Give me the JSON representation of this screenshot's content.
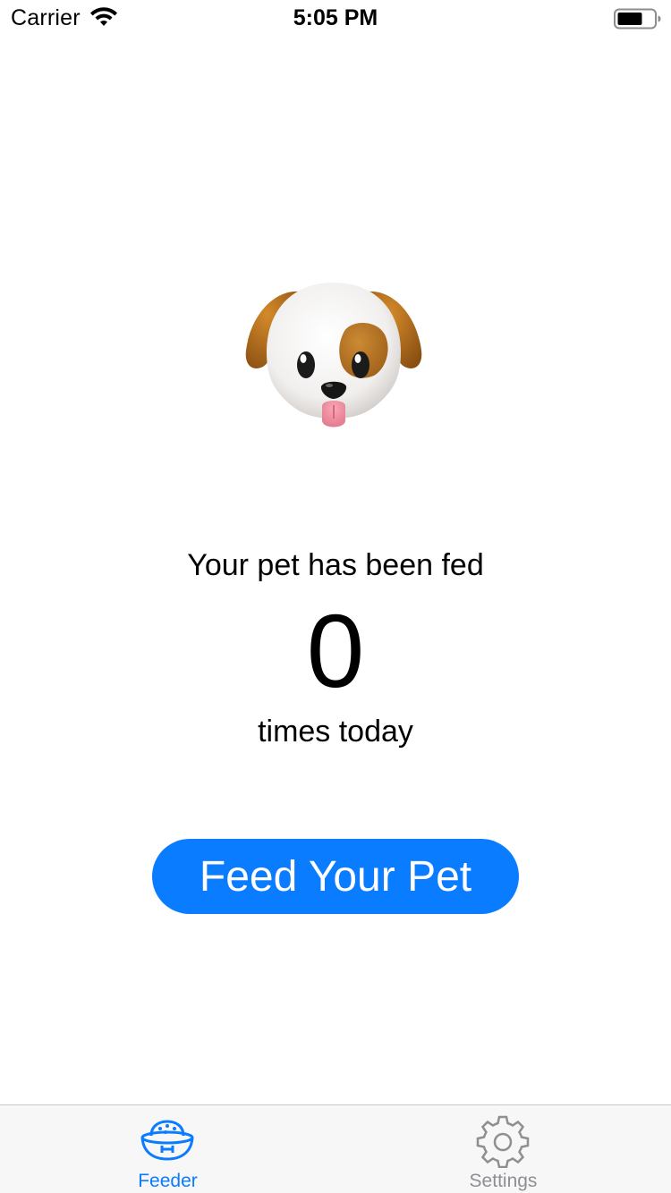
{
  "status_bar": {
    "carrier": "Carrier",
    "time": "5:05 PM",
    "wifi_icon": "wifi-icon",
    "battery_icon": "battery-icon"
  },
  "main": {
    "pet_icon": "dog-face-emoji",
    "fed_label": "Your pet has been fed",
    "feed_count": "0",
    "times_label": "times today",
    "feed_button_label": "Feed Your Pet"
  },
  "tab_bar": {
    "tabs": [
      {
        "label": "Feeder",
        "icon": "pet-bowl-icon",
        "selected": true
      },
      {
        "label": "Settings",
        "icon": "gear-icon",
        "selected": false
      }
    ]
  },
  "colors": {
    "accent": "#0a7cff",
    "tab_inactive": "#8e8e93",
    "tab_bar_bg": "#f7f7f7"
  }
}
